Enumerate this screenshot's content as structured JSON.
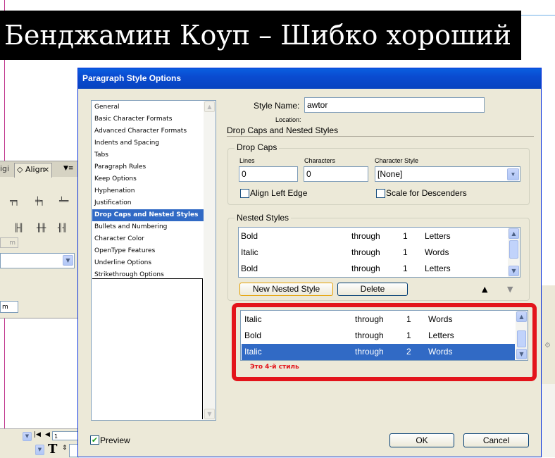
{
  "document": {
    "title": "Бенджамин Коуп – Шибко хороший"
  },
  "align_panel": {
    "tab_prev": "igi",
    "tab_label": "◇ Align",
    "close": "×",
    "menu_arrows": "▼≡",
    "field_dimmed": "m",
    "field_value": "m"
  },
  "bottom_toolbar": {
    "page_value": "1",
    "text_icon": "T"
  },
  "dialog": {
    "title": "Paragraph Style Options",
    "style_name_label": "Style Name:",
    "style_name_value": "awtor",
    "location_label": "Location:",
    "section_title": "Drop Caps and Nested Styles",
    "categories": [
      "General",
      "Basic Character Formats",
      "Advanced Character Formats",
      "Indents and Spacing",
      "Tabs",
      "Paragraph Rules",
      "Keep Options",
      "Hyphenation",
      "Justification",
      "Drop Caps and Nested Styles",
      "Bullets and Numbering",
      "Character Color",
      "OpenType Features",
      "Underline Options",
      "Strikethrough Options"
    ],
    "selected_category": "Drop Caps and Nested Styles",
    "drop_caps": {
      "group_label": "Drop Caps",
      "lines_label": "Lines",
      "lines_value": "0",
      "characters_label": "Characters",
      "characters_value": "0",
      "char_style_label": "Character Style",
      "char_style_value": "[None]",
      "align_left_edge_label": "Align Left Edge",
      "scale_descenders_label": "Scale for Descenders"
    },
    "nested_styles": {
      "group_label": "Nested Styles",
      "rows": [
        {
          "style": "Bold",
          "mode": "through",
          "count": "1",
          "unit": "Letters"
        },
        {
          "style": "Italic",
          "mode": "through",
          "count": "1",
          "unit": "Words"
        },
        {
          "style": "Bold",
          "mode": "through",
          "count": "1",
          "unit": "Letters"
        }
      ],
      "new_button": "New Nested Style",
      "delete_button": "Delete",
      "up_arrow": "▲",
      "down_arrow": "▼"
    },
    "callout": {
      "rows": [
        {
          "style": "Italic",
          "mode": "through",
          "count": "1",
          "unit": "Words"
        },
        {
          "style": "Bold",
          "mode": "through",
          "count": "1",
          "unit": "Letters"
        },
        {
          "style": "Italic",
          "mode": "through",
          "count": "2",
          "unit": "Words"
        }
      ],
      "note": "Это 4-й стиль",
      "border_color": "#e3141b"
    },
    "preview_label": "Preview",
    "ok_button": "OK",
    "cancel_button": "Cancel"
  }
}
